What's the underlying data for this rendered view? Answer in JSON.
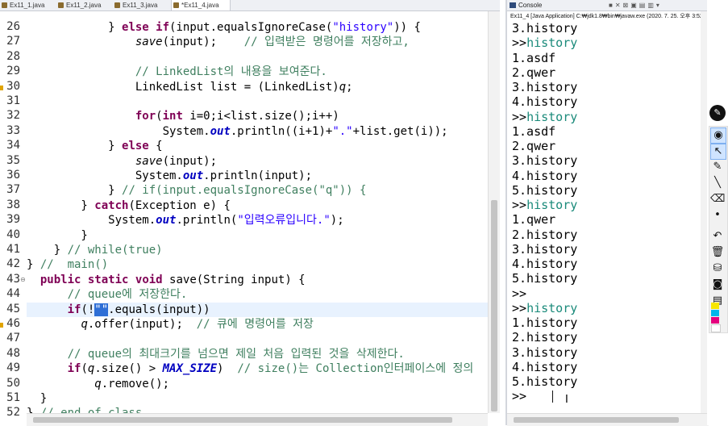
{
  "editor": {
    "tabs": [
      {
        "label": "Ex11_1.java",
        "active": false
      },
      {
        "label": "Ex11_2.java",
        "active": false
      },
      {
        "label": "Ex11_3.java",
        "active": false
      },
      {
        "label": "*Ex11_4.java",
        "active": true
      }
    ],
    "current_line": 45,
    "lines": [
      {
        "n": "26",
        "segs": [
          {
            "t": "            } "
          },
          {
            "t": "else",
            "c": "kw"
          },
          {
            "t": " "
          },
          {
            "t": "if",
            "c": "kw"
          },
          {
            "t": "(input.equalsIgnoreCase("
          },
          {
            "t": "\"history\"",
            "c": "str"
          },
          {
            "t": ")) {"
          }
        ]
      },
      {
        "n": "27",
        "segs": [
          {
            "t": "                "
          },
          {
            "t": "save",
            "c": "it"
          },
          {
            "t": "(input);    "
          },
          {
            "t": "// 입력받은 명령어를 저장하고,",
            "c": "cm"
          }
        ]
      },
      {
        "n": "28",
        "segs": [
          {
            "t": ""
          }
        ]
      },
      {
        "n": "29",
        "segs": [
          {
            "t": "                "
          },
          {
            "t": "// LinkedList의 내용을 보여준다.",
            "c": "cm"
          }
        ]
      },
      {
        "n": "30",
        "segs": [
          {
            "t": "                LinkedList list = (LinkedList)"
          },
          {
            "t": "q",
            "c": "it"
          },
          {
            "t": ";"
          }
        ]
      },
      {
        "n": "31",
        "segs": [
          {
            "t": ""
          }
        ]
      },
      {
        "n": "32",
        "segs": [
          {
            "t": "                "
          },
          {
            "t": "for",
            "c": "kw"
          },
          {
            "t": "("
          },
          {
            "t": "int",
            "c": "kw"
          },
          {
            "t": " i=0;i<list.size();i++)"
          }
        ]
      },
      {
        "n": "33",
        "segs": [
          {
            "t": "                    System."
          },
          {
            "t": "out",
            "c": "fld"
          },
          {
            "t": ".println((i+1)+"
          },
          {
            "t": "\".\"",
            "c": "str"
          },
          {
            "t": "+list.get(i));"
          }
        ]
      },
      {
        "n": "34",
        "segs": [
          {
            "t": "            } "
          },
          {
            "t": "else",
            "c": "kw"
          },
          {
            "t": " {"
          }
        ]
      },
      {
        "n": "35",
        "segs": [
          {
            "t": "                "
          },
          {
            "t": "save",
            "c": "it"
          },
          {
            "t": "(input);"
          }
        ]
      },
      {
        "n": "36",
        "segs": [
          {
            "t": "                System."
          },
          {
            "t": "out",
            "c": "fld"
          },
          {
            "t": ".println(input);"
          }
        ]
      },
      {
        "n": "37",
        "segs": [
          {
            "t": "            } "
          },
          {
            "t": "// if(input.equalsIgnoreCase(\"q\")) {",
            "c": "cm"
          }
        ]
      },
      {
        "n": "38",
        "segs": [
          {
            "t": "        } "
          },
          {
            "t": "catch",
            "c": "kw"
          },
          {
            "t": "(Exception e) {"
          }
        ]
      },
      {
        "n": "39",
        "segs": [
          {
            "t": "            System."
          },
          {
            "t": "out",
            "c": "fld"
          },
          {
            "t": ".println("
          },
          {
            "t": "\"입력오류입니다.\"",
            "c": "str"
          },
          {
            "t": ");"
          }
        ]
      },
      {
        "n": "40",
        "segs": [
          {
            "t": "        }"
          }
        ]
      },
      {
        "n": "41",
        "segs": [
          {
            "t": "    } "
          },
          {
            "t": "// while(true)",
            "c": "cm"
          }
        ]
      },
      {
        "n": "42",
        "segs": [
          {
            "t": "} "
          },
          {
            "t": "//  main()",
            "c": "cm"
          }
        ]
      },
      {
        "n": "43",
        "segs": [
          {
            "t": "  "
          },
          {
            "t": "public",
            "c": "kw"
          },
          {
            "t": " "
          },
          {
            "t": "static",
            "c": "kw"
          },
          {
            "t": " "
          },
          {
            "t": "void",
            "c": "kw"
          },
          {
            "t": " save(String input) {"
          }
        ]
      },
      {
        "n": "44",
        "segs": [
          {
            "t": "      "
          },
          {
            "t": "// queue에 저장한다.",
            "c": "cm"
          }
        ]
      },
      {
        "n": "45",
        "segs": [
          {
            "t": "      "
          },
          {
            "t": "if",
            "c": "kw"
          },
          {
            "t": "(!"
          },
          {
            "t": "\"\"",
            "c": "sel"
          },
          {
            "t": ".equals(input))"
          }
        ]
      },
      {
        "n": "46",
        "segs": [
          {
            "t": "        "
          },
          {
            "t": "q",
            "c": "it"
          },
          {
            "t": ".offer(input);  "
          },
          {
            "t": "// 큐에 명령어를 저장",
            "c": "cm"
          }
        ]
      },
      {
        "n": "47",
        "segs": [
          {
            "t": ""
          }
        ]
      },
      {
        "n": "48",
        "segs": [
          {
            "t": "      "
          },
          {
            "t": "// queue의 최대크기를 넘으면 제일 처음 입력된 것을 삭제한다.",
            "c": "cm"
          }
        ]
      },
      {
        "n": "49",
        "segs": [
          {
            "t": "      "
          },
          {
            "t": "if",
            "c": "kw"
          },
          {
            "t": "("
          },
          {
            "t": "q",
            "c": "it"
          },
          {
            "t": ".size() > "
          },
          {
            "t": "MAX_SIZE",
            "c": "fld"
          },
          {
            "t": ")  "
          },
          {
            "t": "// size()는 Collection인터페이스에 정의",
            "c": "cm"
          }
        ]
      },
      {
        "n": "50",
        "segs": [
          {
            "t": "          "
          },
          {
            "t": "q",
            "c": "it"
          },
          {
            "t": ".remove();"
          }
        ]
      },
      {
        "n": "51",
        "segs": [
          {
            "t": "  }"
          }
        ]
      },
      {
        "n": "52",
        "segs": [
          {
            "t": "} "
          },
          {
            "t": "// end of class",
            "c": "cm"
          }
        ]
      }
    ]
  },
  "console": {
    "title": "Console",
    "run_info": "Ex11_4 [Java Application] C:₩jdk1.8₩bin₩javaw.exe (2020. 7. 25. 오후 3:52:13)",
    "prompt": ">>",
    "output": [
      {
        "p": "",
        "t": "3.history"
      },
      {
        "p": ">>",
        "t": "history",
        "in": true
      },
      {
        "p": "",
        "t": "1.asdf"
      },
      {
        "p": "",
        "t": "2.qwer"
      },
      {
        "p": "",
        "t": "3.history"
      },
      {
        "p": "",
        "t": "4.history"
      },
      {
        "p": ">>",
        "t": "history",
        "in": true
      },
      {
        "p": "",
        "t": "1.asdf"
      },
      {
        "p": "",
        "t": "2.qwer"
      },
      {
        "p": "",
        "t": "3.history"
      },
      {
        "p": "",
        "t": "4.history"
      },
      {
        "p": "",
        "t": "5.history"
      },
      {
        "p": ">>",
        "t": "history",
        "in": true
      },
      {
        "p": "",
        "t": "1.qwer"
      },
      {
        "p": "",
        "t": "2.history"
      },
      {
        "p": "",
        "t": "3.history"
      },
      {
        "p": "",
        "t": "4.history"
      },
      {
        "p": "",
        "t": "5.history"
      },
      {
        "p": ">>",
        "t": ""
      },
      {
        "p": ">>",
        "t": "history",
        "in": true
      },
      {
        "p": "",
        "t": "1.history"
      },
      {
        "p": "",
        "t": "2.history"
      },
      {
        "p": "",
        "t": "3.history"
      },
      {
        "p": "",
        "t": "4.history"
      },
      {
        "p": "",
        "t": "5.history"
      },
      {
        "p": ">>",
        "t": ""
      }
    ]
  },
  "annotation_toolbar": {
    "logo": "✎",
    "tools": [
      "eye-icon",
      "cursor-icon",
      "pencil-icon",
      "line-icon",
      "eraser-icon",
      "dot-icon",
      "undo-icon",
      "trash-icon",
      "stamp-icon",
      "camera-icon",
      "clipboard-icon"
    ],
    "colors": [
      "#f7e600",
      "#00b7eb",
      "#e5007e",
      "#ffffff"
    ]
  }
}
